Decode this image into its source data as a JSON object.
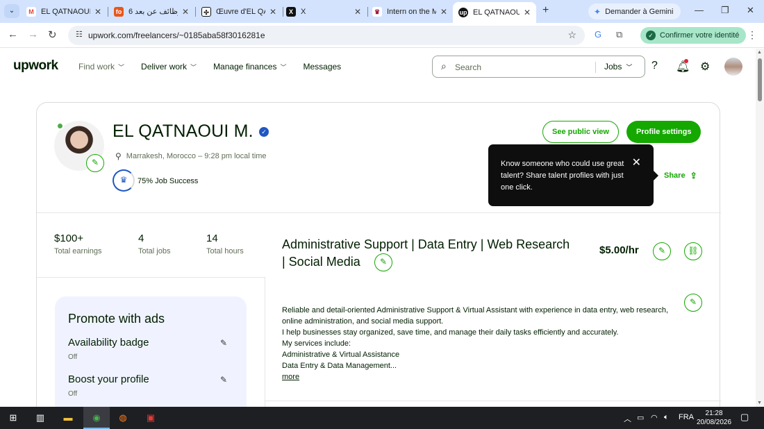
{
  "browser": {
    "tabs": [
      {
        "title": "EL QATNAOUI_y",
        "favicon": "M",
        "color": "#ea4335"
      },
      {
        "title": "وظائف عن بعد 6",
        "favicon": "fo",
        "color": "#e8561c"
      },
      {
        "title": "Œuvre d'EL QAT",
        "favicon": "✣",
        "color": "#111111"
      },
      {
        "title": "X",
        "favicon": "X",
        "color": "#111111"
      },
      {
        "title": "Intern on the M",
        "favicon": "♛",
        "color": "#9b1b3c"
      },
      {
        "title": "EL QATNAOUI M",
        "favicon": "up",
        "color": "#111111",
        "active": true
      }
    ],
    "new_tab": "+",
    "gemini_label": "Demander à Gemini",
    "url": "upwork.com/freelancers/~0185aba58f3016281e",
    "verify_label": "Confirmer votre identité"
  },
  "header": {
    "logo": "upwork",
    "nav": [
      {
        "label": "Find work",
        "muted": true
      },
      {
        "label": "Deliver work"
      },
      {
        "label": "Manage finances"
      },
      {
        "label": "Messages"
      }
    ],
    "search_placeholder": "Search",
    "search_scope": "Jobs"
  },
  "profile": {
    "name": "EL QATNAOUI M.",
    "location": "Marrakesh, Morocco – 9:28 pm local time",
    "job_success": "75% Job Success",
    "buttons": {
      "public_view": "See public view",
      "settings": "Profile settings"
    },
    "share_label": "Share",
    "tooltip": "Know someone who could use great talent? Share talent profiles with just one click.",
    "stats": [
      {
        "value": "$100+",
        "label": "Total earnings"
      },
      {
        "value": "4",
        "label": "Total jobs"
      },
      {
        "value": "14",
        "label": "Total hours"
      }
    ],
    "title_line1": "Administrative Support | Data Entry | Web Research",
    "title_line2": "| Social Media",
    "rate": "$5.00/hr",
    "description": [
      "Reliable and detail-oriented Administrative Support & Virtual Assistant with experience in data entry, web research, online administration, and social media support.",
      "I help businesses stay organized, save time, and manage their daily tasks efficiently and accurately.",
      "My services include:",
      "Administrative & Virtual Assistance",
      "Data Entry & Data Management..."
    ],
    "more_label": "more"
  },
  "promote": {
    "heading": "Promote with ads",
    "items": [
      {
        "title": "Availability badge",
        "status": "Off"
      },
      {
        "title": "Boost your profile",
        "status": "Off"
      }
    ]
  },
  "taskbar": {
    "language": "FRA",
    "time": "21:28",
    "date": "20/08/2026"
  }
}
